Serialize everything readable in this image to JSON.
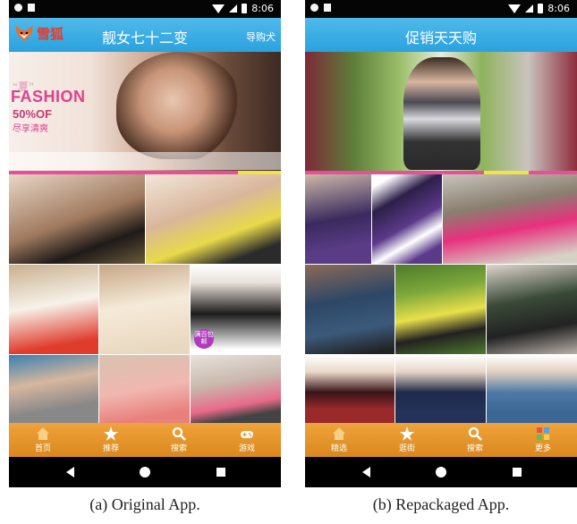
{
  "status_bar": {
    "time": "8:06"
  },
  "original": {
    "logo_text": "雪狐",
    "title": "靓女七十二变",
    "right_link": "导购犬",
    "banner": {
      "line1": "“夏”",
      "line2": "FASHION",
      "line3": "50%OF",
      "line4": "尽享清爽"
    },
    "badge": "满百包邮",
    "nav": [
      {
        "label": "首页",
        "icon": "home-icon"
      },
      {
        "label": "推荐",
        "icon": "star-icon"
      },
      {
        "label": "搜索",
        "icon": "search-icon"
      },
      {
        "label": "游戏",
        "icon": "gamepad-icon"
      }
    ],
    "caption": "(a) Original App."
  },
  "repackaged": {
    "title": "促销天天购",
    "nav": [
      {
        "label": "精选",
        "icon": "home-icon"
      },
      {
        "label": "逛街",
        "icon": "star-icon"
      },
      {
        "label": "搜索",
        "icon": "search-icon"
      },
      {
        "label": "更多",
        "icon": "grid-icon"
      }
    ],
    "caption": "(b) Repackaged App."
  },
  "colors": {
    "appbar": "#2ba2de",
    "navbar": "#e8962c",
    "stripe_pink": "#e84f9a",
    "stripe_yellow": "#f1e34a"
  }
}
